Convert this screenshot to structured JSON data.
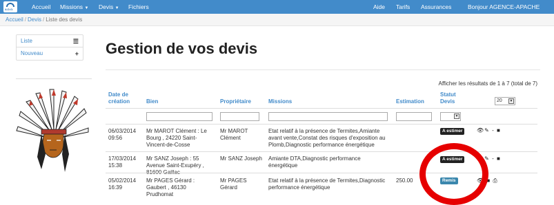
{
  "navbar": {
    "logo_text": "A.D.O.",
    "left": [
      {
        "label": "Accueil"
      },
      {
        "label": "Missions",
        "dropdown": true
      },
      {
        "label": "Devis",
        "dropdown": true
      },
      {
        "label": "Fichiers"
      }
    ],
    "right": [
      {
        "label": "Aide"
      },
      {
        "label": "Tarifs"
      },
      {
        "label": "Assurances"
      },
      {
        "label": "Bonjour AGENCE-APACHE"
      }
    ]
  },
  "breadcrumb": {
    "items": [
      "Accueil",
      "Devis"
    ],
    "current": "Liste des devis"
  },
  "sidebar": {
    "items": [
      {
        "label": "Liste",
        "icon": "list-icon"
      },
      {
        "label": "Nouveau",
        "icon": "plus-icon"
      }
    ]
  },
  "page": {
    "title": "Gestion de vos devis",
    "results": "Afficher les résultats de 1 à 7 (total de 7)"
  },
  "table": {
    "headers": {
      "date": [
        "Date de",
        "création"
      ],
      "bien": "Bien",
      "proprietaire": "Propriétaire",
      "missions": "Missions",
      "estimation": "Estimation",
      "statut": [
        "Statut",
        "Devis"
      ]
    },
    "page_size": "20",
    "rows": [
      {
        "date": [
          "06/03/2014",
          "09:56"
        ],
        "bien": [
          "Mr MAROT Clément : Le",
          "Bourg , 24220 Saint-",
          "Vincent-de-Cosse"
        ],
        "proprietaire": [
          "Mr MAROT",
          "Clément"
        ],
        "missions": [
          "Etat relatif à la présence de Termites,Amiante",
          "avant vente,Constat des risques d'exposition au",
          "Plomb,Diagnostic performance énergétique"
        ],
        "estimation": "",
        "statut": "A estimer",
        "statut_style": "dark",
        "actions": "👁✎ - ■"
      },
      {
        "date": [
          "17/03/2014",
          "15:38"
        ],
        "bien": [
          "Mr SANZ Joseph : 55",
          "Avenue Saint-Exupéry ,",
          "81600 Gaillac"
        ],
        "proprietaire": [
          "Mr SANZ Joseph"
        ],
        "missions": [
          "Amiante DTA,Diagnostic performance",
          "énergétique"
        ],
        "estimation": "",
        "statut": "A estimer",
        "statut_style": "dark",
        "actions": "👁✎ - ■"
      },
      {
        "date": [
          "05/02/2014",
          "16:39"
        ],
        "bien": [
          "Mr PAGES Gérard :",
          "Gaubert , 46130",
          "Prudhomat"
        ],
        "proprietaire": [
          "Mr PAGES",
          "Gérard"
        ],
        "missions": [
          "Etat relatif à la présence de Termites,Diagnostic",
          "performance énergétique"
        ],
        "estimation": "250.00",
        "statut": "Remis",
        "statut_style": "info",
        "actions": "👁 ■ ⎙"
      }
    ]
  },
  "colors": {
    "navbar": "#428bca",
    "link": "#428bca",
    "highlight_ring": "#e60000"
  }
}
